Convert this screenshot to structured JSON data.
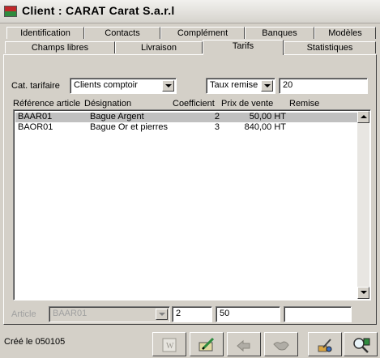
{
  "window": {
    "title": "Client : CARAT Carat S.a.r.l"
  },
  "tabs": {
    "row1": [
      "Identification",
      "Contacts",
      "Complément",
      "Banques",
      "Modèles"
    ],
    "row2": [
      "Champs libres",
      "Livraison",
      "Tarifs",
      "Statistiques"
    ],
    "active": "Tarifs"
  },
  "filters": {
    "cat_label": "Cat. tarifaire",
    "cat_value": "Clients comptoir",
    "remise_type": "Taux remise",
    "remise_value": "20"
  },
  "table": {
    "headers": [
      "Référence article",
      "Désignation",
      "Coefficient",
      "Prix de vente",
      "Remise"
    ],
    "rows": [
      {
        "ref": "BAAR01",
        "designation": "Bague Argent",
        "coef": "2",
        "prix": "50,00 HT",
        "remise": ""
      },
      {
        "ref": "BAOR01",
        "designation": "Bague Or et pierres",
        "coef": "3",
        "prix": "840,00 HT",
        "remise": ""
      }
    ],
    "selected_index": 0
  },
  "editor": {
    "article_label": "Article",
    "article_value": "BAAR01",
    "coef_value": "2",
    "prix_value": "50",
    "remise_value": ""
  },
  "status": {
    "created": "Créé le 050105"
  },
  "toolbar": {
    "buttons": [
      "word-icon",
      "edit-icon",
      "transfer-icon",
      "handshake-icon",
      "tools-icon",
      "search-icon"
    ]
  },
  "colors": {
    "face": "#d4d0c8",
    "selection": "#c0c0c0",
    "icon_red": "#c0282a",
    "icon_green": "#2e8b3e"
  }
}
